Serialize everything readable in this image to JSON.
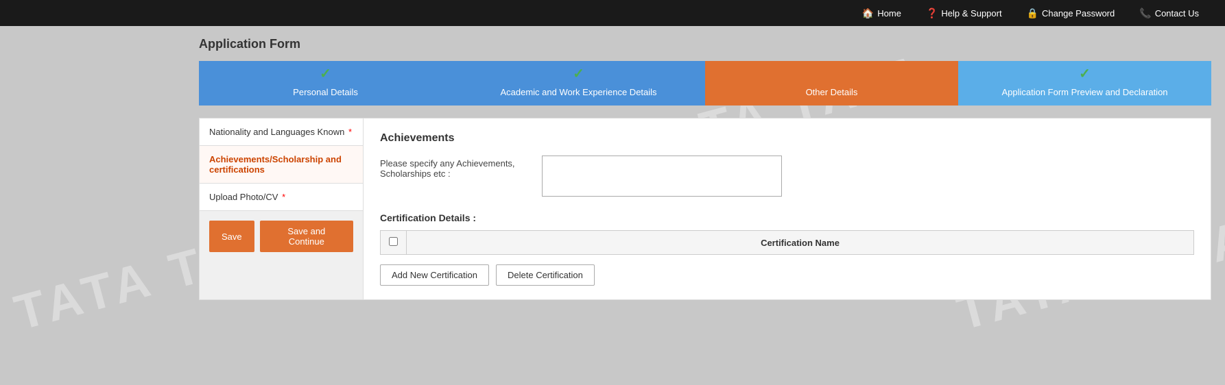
{
  "nav": {
    "home_label": "Home",
    "help_label": "Help & Support",
    "change_password_label": "Change Password",
    "contact_label": "Contact Us"
  },
  "page": {
    "title": "Application Form"
  },
  "steps": [
    {
      "id": "personal",
      "label": "Personal Details",
      "type": "blue",
      "checked": true
    },
    {
      "id": "academic",
      "label": "Academic and Work Experience Details",
      "type": "blue",
      "checked": true
    },
    {
      "id": "other",
      "label": "Other Details",
      "type": "orange",
      "checked": false
    },
    {
      "id": "preview",
      "label": "Application Form Preview and Declaration",
      "type": "light-blue",
      "checked": true
    }
  ],
  "sidebar": {
    "items": [
      {
        "id": "nationality",
        "label": "Nationality and Languages Known",
        "required": true,
        "active": false
      },
      {
        "id": "achievements",
        "label": "Achievements/Scholarship and certifications",
        "required": false,
        "active": true
      },
      {
        "id": "upload",
        "label": "Upload Photo/CV",
        "required": true,
        "active": false
      }
    ],
    "save_label": "Save",
    "save_continue_label": "Save and Continue"
  },
  "achievements": {
    "section_title": "Achievements",
    "field_label": "Please specify any Achievements, Scholarships etc :",
    "textarea_placeholder": "",
    "cert_section_title": "Certification Details :",
    "cert_table_header_checkbox": "",
    "cert_table_header_name": "Certification Name",
    "add_cert_label": "Add New Certification",
    "delete_cert_label": "Delete Certification"
  },
  "watermark": {
    "text": "TATA   TATA   TATA   TATA   TATA   TATA"
  }
}
